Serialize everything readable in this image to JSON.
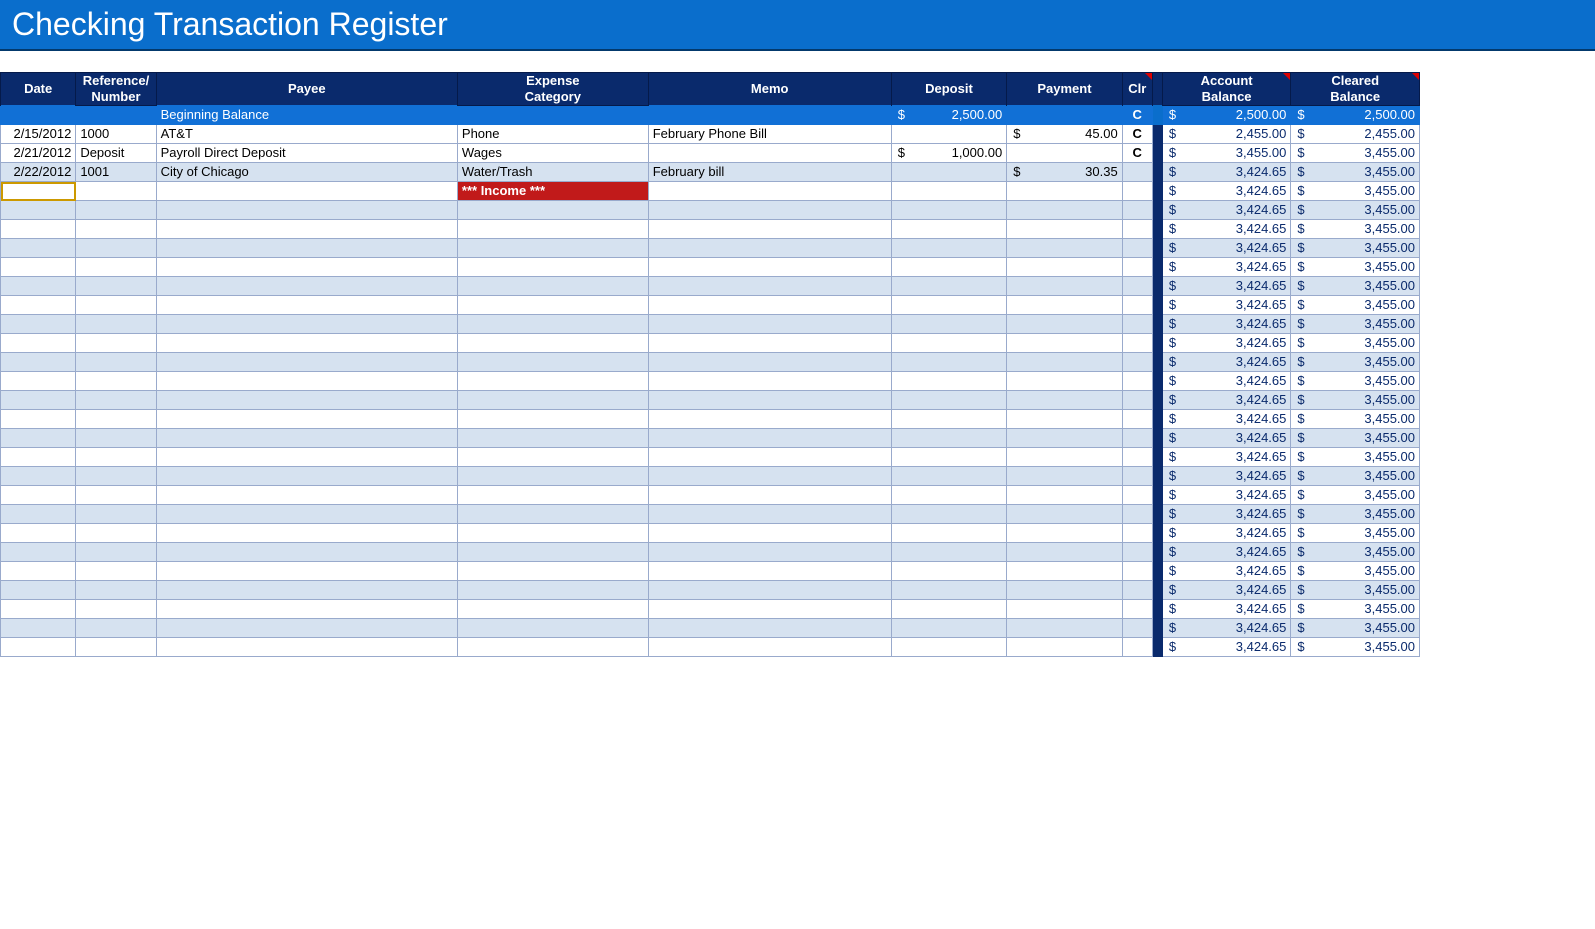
{
  "title": "Checking Transaction Register",
  "headers": {
    "date": "Date",
    "ref_top": "Reference/",
    "ref_bot": "Number",
    "payee": "Payee",
    "cat_top": "Expense",
    "cat_bot": "Category",
    "memo": "Memo",
    "deposit": "Deposit",
    "payment": "Payment",
    "clr": "Clr",
    "acct_top": "Account",
    "acct_bot": "Balance",
    "clrd_top": "Cleared",
    "clrd_bot": "Balance"
  },
  "rows": [
    {
      "type": "begin",
      "date": "",
      "ref": "",
      "payee": "Beginning Balance",
      "cat": "",
      "memo": "",
      "deposit": "2,500.00",
      "payment": "",
      "clr": "C",
      "bal": "2,500.00",
      "cbal": "2,500.00"
    },
    {
      "type": "data",
      "date": "2/15/2012",
      "ref": "1000",
      "payee": "AT&T",
      "cat": "Phone",
      "memo": "February Phone Bill",
      "deposit": "",
      "payment": "45.00",
      "clr": "C",
      "bal": "2,455.00",
      "cbal": "2,455.00",
      "shade": "light"
    },
    {
      "type": "data",
      "date": "2/21/2012",
      "ref": "Deposit",
      "payee": "Payroll Direct Deposit",
      "cat": "Wages",
      "memo": "",
      "deposit": "1,000.00",
      "payment": "",
      "clr": "C",
      "bal": "3,455.00",
      "cbal": "3,455.00",
      "shade": "light"
    },
    {
      "type": "data",
      "date": "2/22/2012",
      "ref": "1001",
      "payee": "City of Chicago",
      "cat": "Water/Trash",
      "memo": "February bill",
      "deposit": "",
      "payment": "30.35",
      "clr": "",
      "bal": "3,424.65",
      "cbal": "3,455.00",
      "shade": "shade"
    },
    {
      "type": "data",
      "active": true,
      "date": "",
      "ref": "",
      "payee": "",
      "cat": "*** Income ***",
      "redcat": true,
      "memo": "",
      "deposit": "",
      "payment": "",
      "clr": "",
      "bal": "3,424.65",
      "cbal": "3,455.00",
      "shade": "light"
    },
    {
      "type": "blank",
      "shade": "shade",
      "bal": "3,424.65",
      "cbal": "3,455.00"
    },
    {
      "type": "blank",
      "shade": "light",
      "bal": "3,424.65",
      "cbal": "3,455.00"
    },
    {
      "type": "blank",
      "shade": "shade",
      "bal": "3,424.65",
      "cbal": "3,455.00"
    },
    {
      "type": "blank",
      "shade": "light",
      "bal": "3,424.65",
      "cbal": "3,455.00"
    },
    {
      "type": "blank",
      "shade": "shade",
      "bal": "3,424.65",
      "cbal": "3,455.00"
    },
    {
      "type": "blank",
      "shade": "light",
      "bal": "3,424.65",
      "cbal": "3,455.00"
    },
    {
      "type": "blank",
      "shade": "shade",
      "bal": "3,424.65",
      "cbal": "3,455.00"
    },
    {
      "type": "blank",
      "shade": "light",
      "bal": "3,424.65",
      "cbal": "3,455.00"
    },
    {
      "type": "blank",
      "shade": "shade",
      "bal": "3,424.65",
      "cbal": "3,455.00"
    },
    {
      "type": "blank",
      "shade": "light",
      "bal": "3,424.65",
      "cbal": "3,455.00"
    },
    {
      "type": "blank",
      "shade": "shade",
      "bal": "3,424.65",
      "cbal": "3,455.00"
    },
    {
      "type": "blank",
      "shade": "light",
      "bal": "3,424.65",
      "cbal": "3,455.00"
    },
    {
      "type": "blank",
      "shade": "shade",
      "bal": "3,424.65",
      "cbal": "3,455.00"
    },
    {
      "type": "blank",
      "shade": "light",
      "bal": "3,424.65",
      "cbal": "3,455.00"
    },
    {
      "type": "blank",
      "shade": "shade",
      "bal": "3,424.65",
      "cbal": "3,455.00"
    },
    {
      "type": "blank",
      "shade": "light",
      "bal": "3,424.65",
      "cbal": "3,455.00"
    },
    {
      "type": "blank",
      "shade": "shade",
      "bal": "3,424.65",
      "cbal": "3,455.00"
    },
    {
      "type": "blank",
      "shade": "light",
      "bal": "3,424.65",
      "cbal": "3,455.00"
    },
    {
      "type": "blank",
      "shade": "shade",
      "bal": "3,424.65",
      "cbal": "3,455.00"
    },
    {
      "type": "blank",
      "shade": "light",
      "bal": "3,424.65",
      "cbal": "3,455.00"
    },
    {
      "type": "blank",
      "shade": "shade",
      "bal": "3,424.65",
      "cbal": "3,455.00"
    },
    {
      "type": "blank",
      "shade": "light",
      "bal": "3,424.65",
      "cbal": "3,455.00"
    },
    {
      "type": "blank",
      "shade": "shade",
      "bal": "3,424.65",
      "cbal": "3,455.00"
    },
    {
      "type": "blank",
      "shade": "light",
      "bal": "3,424.65",
      "cbal": "3,455.00"
    }
  ]
}
